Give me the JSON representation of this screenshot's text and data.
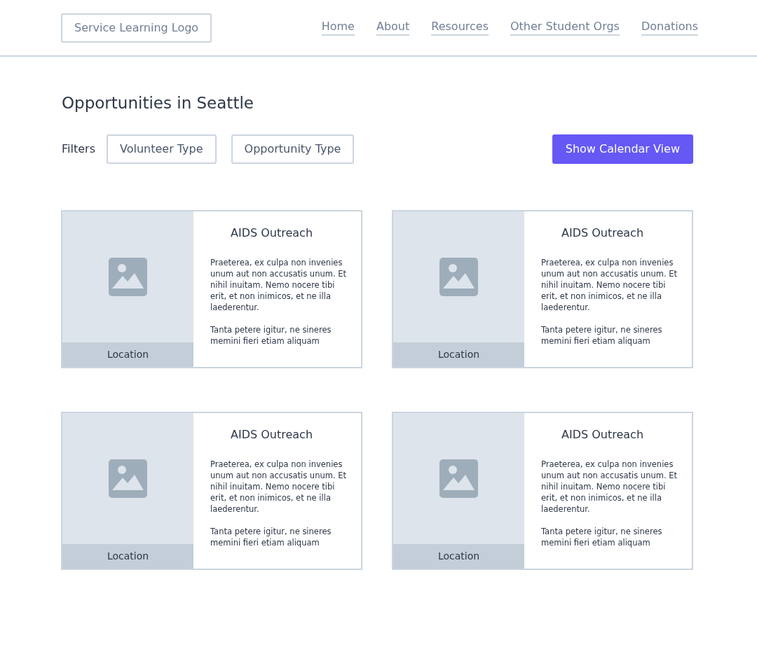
{
  "header": {
    "logo": "Service Learning Logo",
    "nav": [
      "Home",
      "About",
      "Resources",
      "Other Student Orgs",
      "Donations"
    ]
  },
  "page_title": "Opportunities in Seattle",
  "filters": {
    "label": "Filters",
    "buttons": [
      "Volunteer Type",
      "Opportunity Type"
    ]
  },
  "calendar_button": "Show Calendar View",
  "cards": [
    {
      "title": "AIDS Outreach",
      "location": "Location",
      "paragraphs": [
        "Praeterea, ex culpa non invenies unum aut non accusatis unum. Et nihil inuitam. Nemo nocere tibi erit, et non inimicos, et ne illa laederentur.",
        "Tanta petere igitur, ne sineres memini fieri etiam aliquam"
      ]
    },
    {
      "title": "AIDS Outreach",
      "location": "Location",
      "paragraphs": [
        "Praeterea, ex culpa non invenies unum aut non accusatis unum. Et nihil inuitam. Nemo nocere tibi erit, et non inimicos, et ne illa laederentur.",
        "Tanta petere igitur, ne sineres memini fieri etiam aliquam"
      ]
    },
    {
      "title": "AIDS Outreach",
      "location": "Location",
      "paragraphs": [
        "Praeterea, ex culpa non invenies unum aut non accusatis unum. Et nihil inuitam. Nemo nocere tibi erit, et non inimicos, et ne illa laederentur.",
        "Tanta petere igitur, ne sineres memini fieri etiam aliquam"
      ]
    },
    {
      "title": "AIDS Outreach",
      "location": "Location",
      "paragraphs": [
        "Praeterea, ex culpa non invenies unum aut non accusatis unum. Et nihil inuitam. Nemo nocere tibi erit, et non inimicos, et ne illa laederentur.",
        "Tanta petere igitur, ne sineres memini fieri etiam aliquam"
      ]
    }
  ]
}
